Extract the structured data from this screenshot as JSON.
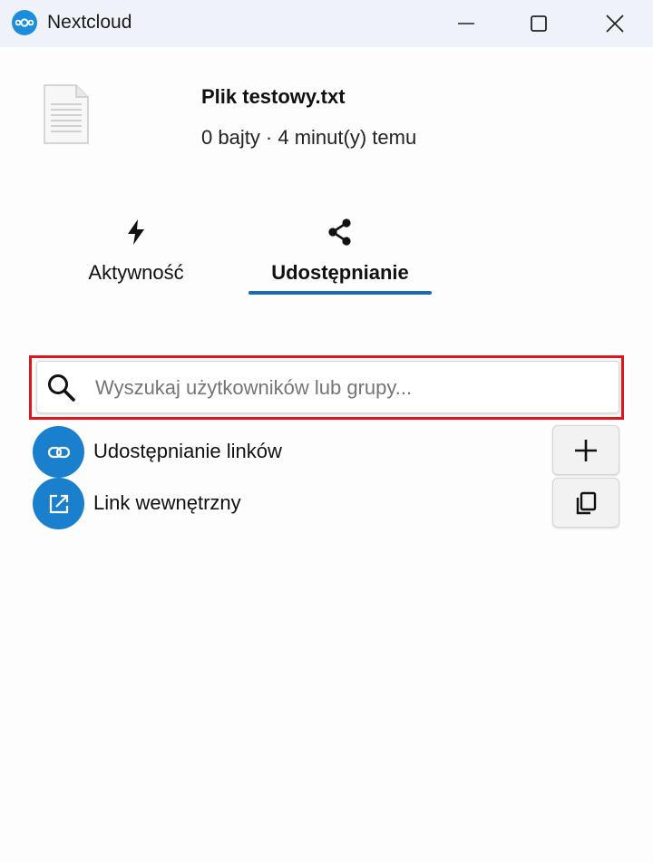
{
  "window": {
    "title": "Nextcloud",
    "logo_icon": "nextcloud-logo",
    "controls": [
      "minimize-icon",
      "maximize-icon",
      "close-icon"
    ]
  },
  "file": {
    "name": "Plik testowy.txt",
    "meta": "0 bajty · 4 minut(y) temu",
    "icon": "text-file-icon"
  },
  "tabs": [
    {
      "label": "Aktywność",
      "icon": "lightning-icon",
      "active": false
    },
    {
      "label": "Udostępnianie",
      "icon": "share-icon",
      "active": true
    }
  ],
  "search": {
    "value": "",
    "placeholder": "Wyszukaj użytkowników lub grupy...",
    "icon": "search-icon",
    "highlighted": true
  },
  "share_rows": [
    {
      "label": "Udostępnianie linków",
      "icon": "link-icon",
      "action_icon": "plus-icon"
    },
    {
      "label": "Link wewnętrzny",
      "icon": "external-link-icon",
      "action_icon": "copy-icon"
    }
  ],
  "colors": {
    "accent": "#1a7fcc",
    "tab_underline": "#1a68b8",
    "highlight_border": "#e1141b",
    "titlebar_bg": "#eff3f9"
  }
}
